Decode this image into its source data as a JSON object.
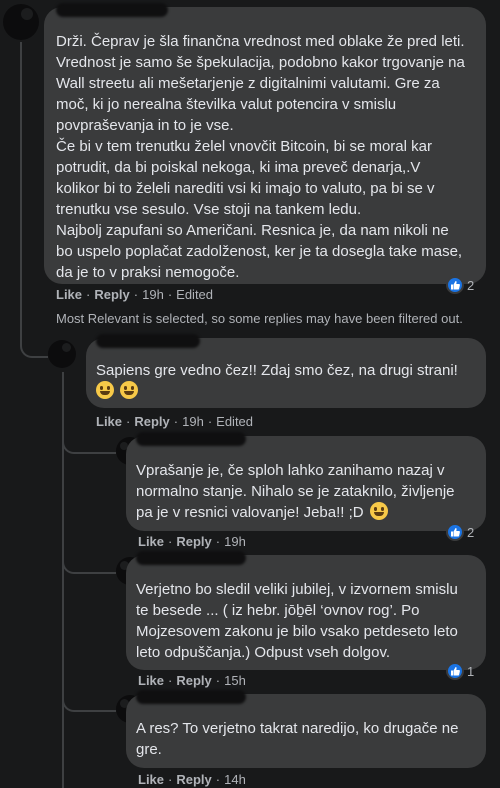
{
  "colors": {
    "background": "#18191a",
    "bubble": "#3a3b3c",
    "text": "#e4e6eb",
    "meta": "#b0b3b8",
    "like_blue": "#1b74e4"
  },
  "comment_main": {
    "lines": [
      "Drži. Čeprav je šla finančna vrednost med oblake že pred leti.",
      "Vrednost je samo še špekulacija, podobno kakor trgovanje na",
      "Wall streetu ali mešetarjenje z digitalnimi valutami. Gre za",
      "moč, ki jo nerealna številka valut potencira v smislu",
      "povpraševanja in to je vse.",
      "Če bi v tem trenutku želel vnovčit Bitcoin, bi se moral kar",
      "potrudit, da bi poiskal nekoga, ki ima preveč denarja,.V",
      "kolikor bi to želeli narediti vsi ki imajo to valuto, pa bi se v",
      "trenutku vse sesulo. Vse stoji na tankem ledu.",
      "Najbolj zapufani so Američani. Resnica je, da nam nikoli ne",
      "bo uspelo poplačat zadolženost, ker je ta dosegla take mase,",
      "da je to v praksi nemogoče."
    ],
    "like": "Like",
    "reply": "Reply",
    "time": "19h",
    "edited": "Edited",
    "reaction_icon": "like-icon",
    "reaction_count": "2"
  },
  "filter_note": "Most Relevant is selected, so some replies may have been filtered out.",
  "reply1": {
    "lines": [
      "Sapiens gre vedno čez!! Zdaj smo čez, na drugi strani!"
    ],
    "emojis": [
      "grinning-face-icon",
      "grinning-face-icon"
    ],
    "like": "Like",
    "reply": "Reply",
    "time": "19h",
    "edited": "Edited"
  },
  "reply2": {
    "lines": [
      "Vprašanje je, če sploh lahko zanihamo nazaj v",
      "normalno stanje. Nihalo se je zataknilo, življenje",
      "pa je v resnici valovanje! Jeba!! ;D"
    ],
    "emoji": "grinning-face-icon",
    "like": "Like",
    "reply": "Reply",
    "time": "19h",
    "reaction_icon": "like-icon",
    "reaction_count": "2"
  },
  "reply3": {
    "lines": [
      "Verjetno bo sledil veliki jubilej, v izvornem smislu",
      "te besede ... ( iz hebr. jōḇēl ‘ovnov rog’. Po",
      "Mojzesovem zakonu je bilo vsako petdeseto leto",
      "leto odpuščanja.) Odpust vseh dolgov."
    ],
    "like": "Like",
    "reply": "Reply",
    "time": "15h",
    "reaction_icon": "like-icon",
    "reaction_count": "1"
  },
  "reply4": {
    "lines": [
      "A res? To verjetno takrat naredijo, ko drugače ne",
      "gre."
    ],
    "like": "Like",
    "reply": "Reply",
    "time": "14h"
  }
}
